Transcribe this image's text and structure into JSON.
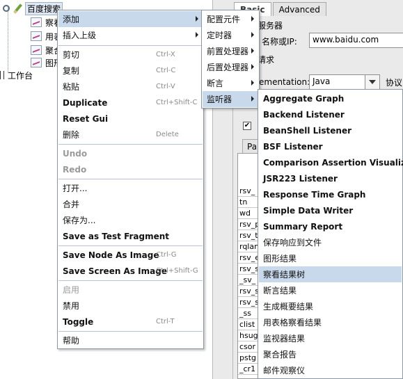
{
  "tree": {
    "root_label": "百度搜索",
    "children": [
      "察看结果树",
      "用表格察看结果",
      "聚合报告",
      "图形结果"
    ],
    "workbench_label": "工作台"
  },
  "right_panel": {
    "tabs": [
      "Basic",
      "Advanced"
    ],
    "server_section": "服务器",
    "server_label": "名称或IP:",
    "server_value": "www.baidu.com",
    "request_section": "请求",
    "impl_label": "ementation:",
    "impl_value": "Java",
    "protocol_label": "协议",
    "params_tab": "Par",
    "params_rows": [
      "rsv_",
      "tn",
      "wd",
      "rsv_p",
      "rsv_t",
      "rqlan",
      "rsv_e",
      "rsv_s",
      "_sv_",
      "rsv_s",
      "rsv_s",
      "_ss",
      "clist",
      "hsug",
      "csor",
      "pstg",
      "_cr1"
    ]
  },
  "menu_main": {
    "items": [
      {
        "label": "添加",
        "submenu": true,
        "highlighted": true
      },
      {
        "label": "插入上级",
        "submenu": true
      },
      {
        "label": "剪切",
        "shortcut": "Ctrl-X"
      },
      {
        "label": "复制",
        "shortcut": "Ctrl-C"
      },
      {
        "label": "粘贴",
        "shortcut": "Ctrl-V"
      },
      {
        "label": "Duplicate",
        "shortcut": "Ctrl+Shift-C"
      },
      {
        "label": "Reset Gui"
      },
      {
        "label": "删除",
        "shortcut": "Delete"
      },
      {
        "label": "Undo",
        "disabled": true
      },
      {
        "label": "Redo",
        "disabled": true
      },
      {
        "label": "打开..."
      },
      {
        "label": "合并"
      },
      {
        "label": "保存为..."
      },
      {
        "label": "Save as Test Fragment"
      },
      {
        "label": "Save Node As Image",
        "shortcut": "Ctrl-G"
      },
      {
        "label": "Save Screen As Image",
        "shortcut": "Ctrl+Shift-G"
      },
      {
        "label": "启用",
        "disabled": true
      },
      {
        "label": "禁用"
      },
      {
        "label": "Toggle",
        "shortcut": "Ctrl-T"
      },
      {
        "label": "帮助"
      }
    ]
  },
  "menu_add": {
    "items": [
      {
        "label": "配置元件",
        "submenu": true
      },
      {
        "label": "定时器",
        "submenu": true
      },
      {
        "label": "前置处理器",
        "submenu": true
      },
      {
        "label": "后置处理器",
        "submenu": true
      },
      {
        "label": "断言",
        "submenu": true
      },
      {
        "label": "监听器",
        "submenu": true,
        "highlighted": true
      }
    ]
  },
  "menu_listener": {
    "items": [
      {
        "label": "Aggregate Graph"
      },
      {
        "label": "Backend Listener"
      },
      {
        "label": "BeanShell Listener"
      },
      {
        "label": "BSF Listener"
      },
      {
        "label": "Comparison Assertion Visualizer"
      },
      {
        "label": "JSR223 Listener"
      },
      {
        "label": "Response Time Graph"
      },
      {
        "label": "Simple Data Writer"
      },
      {
        "label": "Summary Report"
      },
      {
        "label": "保存响应到文件"
      },
      {
        "label": "图形结果"
      },
      {
        "label": "察看结果树",
        "highlighted": true
      },
      {
        "label": "断言结果"
      },
      {
        "label": "生成概要结果"
      },
      {
        "label": "用表格察看结果"
      },
      {
        "label": "监视器结果"
      },
      {
        "label": "聚合报告"
      },
      {
        "label": "邮件观察仪"
      }
    ]
  },
  "colors": {
    "menu_highlight": "#c8d9ec",
    "menu_border": "#8b97a5",
    "disabled_text": "#9a9a9a"
  }
}
